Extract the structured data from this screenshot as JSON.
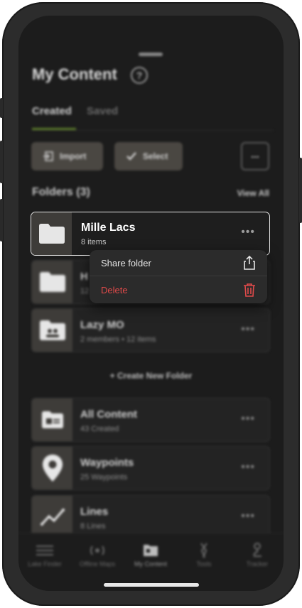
{
  "header": {
    "title": "My Content",
    "help_icon": "question-circle-icon"
  },
  "tabs": [
    {
      "label": "Created",
      "active": true
    },
    {
      "label": "Saved",
      "active": false
    }
  ],
  "toolbar": {
    "import_label": "Import",
    "select_label": "Select",
    "more_label": "..."
  },
  "folders_section": {
    "title": "Folders (3)",
    "view_all": "View All"
  },
  "folders": [
    {
      "name": "Mille Lacs",
      "sub": "8 items",
      "icon": "folder-icon",
      "selected": true
    },
    {
      "name": "H",
      "sub": "12",
      "icon": "folder-icon"
    },
    {
      "name": "Lazy MO",
      "sub": "2 members • 12 items",
      "icon": "shared-folder-icon"
    }
  ],
  "create_folder": "+ Create New Folder",
  "categories": [
    {
      "name": "All Content",
      "sub": "43 Created",
      "icon": "all-content-icon"
    },
    {
      "name": "Waypoints",
      "sub": "25 Waypoints",
      "icon": "map-pin-icon"
    },
    {
      "name": "Lines",
      "sub": "8 Lines",
      "icon": "line-graph-icon"
    }
  ],
  "context_menu": {
    "share_label": "Share folder",
    "delete_label": "Delete",
    "share_icon": "share-icon",
    "delete_icon": "trash-icon",
    "delete_color": "#e04a4a"
  },
  "tabbar": [
    {
      "label": "Lake Finder",
      "icon": "lake-finder-icon"
    },
    {
      "label": "Offline Maps",
      "icon": "offline-maps-icon"
    },
    {
      "label": "My Content",
      "icon": "my-content-icon",
      "active": true
    },
    {
      "label": "Tools",
      "icon": "tools-icon"
    },
    {
      "label": "Tracker",
      "icon": "tracker-icon"
    }
  ]
}
